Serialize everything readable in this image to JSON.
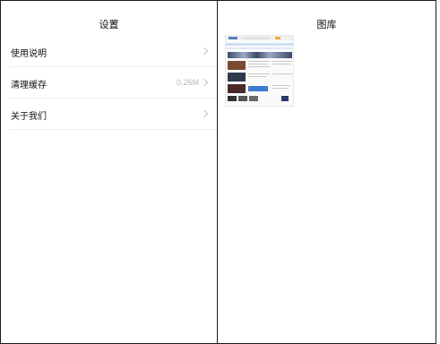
{
  "settings": {
    "title": "设置",
    "items": [
      {
        "label": "使用说明",
        "value": ""
      },
      {
        "label": "清理缓存",
        "value": "0.26M"
      },
      {
        "label": "关于我们",
        "value": ""
      }
    ]
  },
  "gallery": {
    "title": "图库",
    "thumbnails": [
      {
        "icon": "webpage-screenshot-thumbnail"
      }
    ]
  }
}
